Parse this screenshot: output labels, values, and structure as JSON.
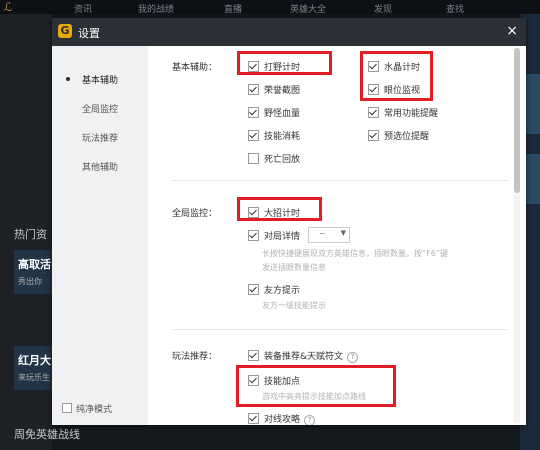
{
  "background": {
    "tabs": [
      "资讯",
      "我的战绩",
      "直播",
      "英雄大全",
      "发现",
      "查找"
    ],
    "sections": [
      "热门资",
      "周免英雄战线"
    ],
    "cards": [
      {
        "title": "高取活",
        "subtitle": "秀出你"
      },
      {
        "title": "红月大",
        "subtitle": "来玩乐生"
      }
    ]
  },
  "dialog": {
    "title": "设置",
    "logo_letter": "G",
    "close_glyph": "×"
  },
  "sidebar": {
    "items": [
      "基本辅助",
      "全局监控",
      "玩法推荐",
      "其他辅助"
    ],
    "active_index": 0,
    "pure_mode": {
      "label": "纯净模式",
      "checked": false
    }
  },
  "sections": {
    "basic": {
      "label": "基本辅助：",
      "options": [
        {
          "label": "打野计时",
          "checked": true
        },
        {
          "label": "水晶计时",
          "checked": true
        },
        {
          "label": "荣誉截图",
          "checked": true
        },
        {
          "label": "眼位监视",
          "checked": true
        },
        {
          "label": "野怪血量",
          "checked": true
        },
        {
          "label": "常用功能提醒",
          "checked": true
        },
        {
          "label": "技能消耗",
          "checked": true
        },
        {
          "label": "预选位提醒",
          "checked": true
        },
        {
          "label": "死亡回放",
          "checked": false
        }
      ]
    },
    "global": {
      "label": "全局监控：",
      "ult_timer": {
        "label": "大招计时",
        "checked": true
      },
      "match_detail": {
        "label": "对局详情",
        "checked": true,
        "dropdown_value": "~",
        "hint_line1": "长按快捷键展现双方英雄信息，插眼数量。按“F6”键",
        "hint_line2": "发送插眼数量信息"
      },
      "ally_tip": {
        "label": "友方提示",
        "checked": true,
        "hint": "友方一级技能提示"
      }
    },
    "play": {
      "label": "玩法推荐：",
      "equip": {
        "label": "装备推荐&天赋符文",
        "checked": true
      },
      "skill_points": {
        "label": "技能加点",
        "checked": true,
        "hint": "游戏中高亮提示技能加点路线"
      },
      "lane_guide": {
        "label": "对线攻略",
        "checked": true
      }
    }
  },
  "colors": {
    "highlight": "#e01e25",
    "titlebar": "#2b2f36",
    "logo": "#e9a80c"
  }
}
